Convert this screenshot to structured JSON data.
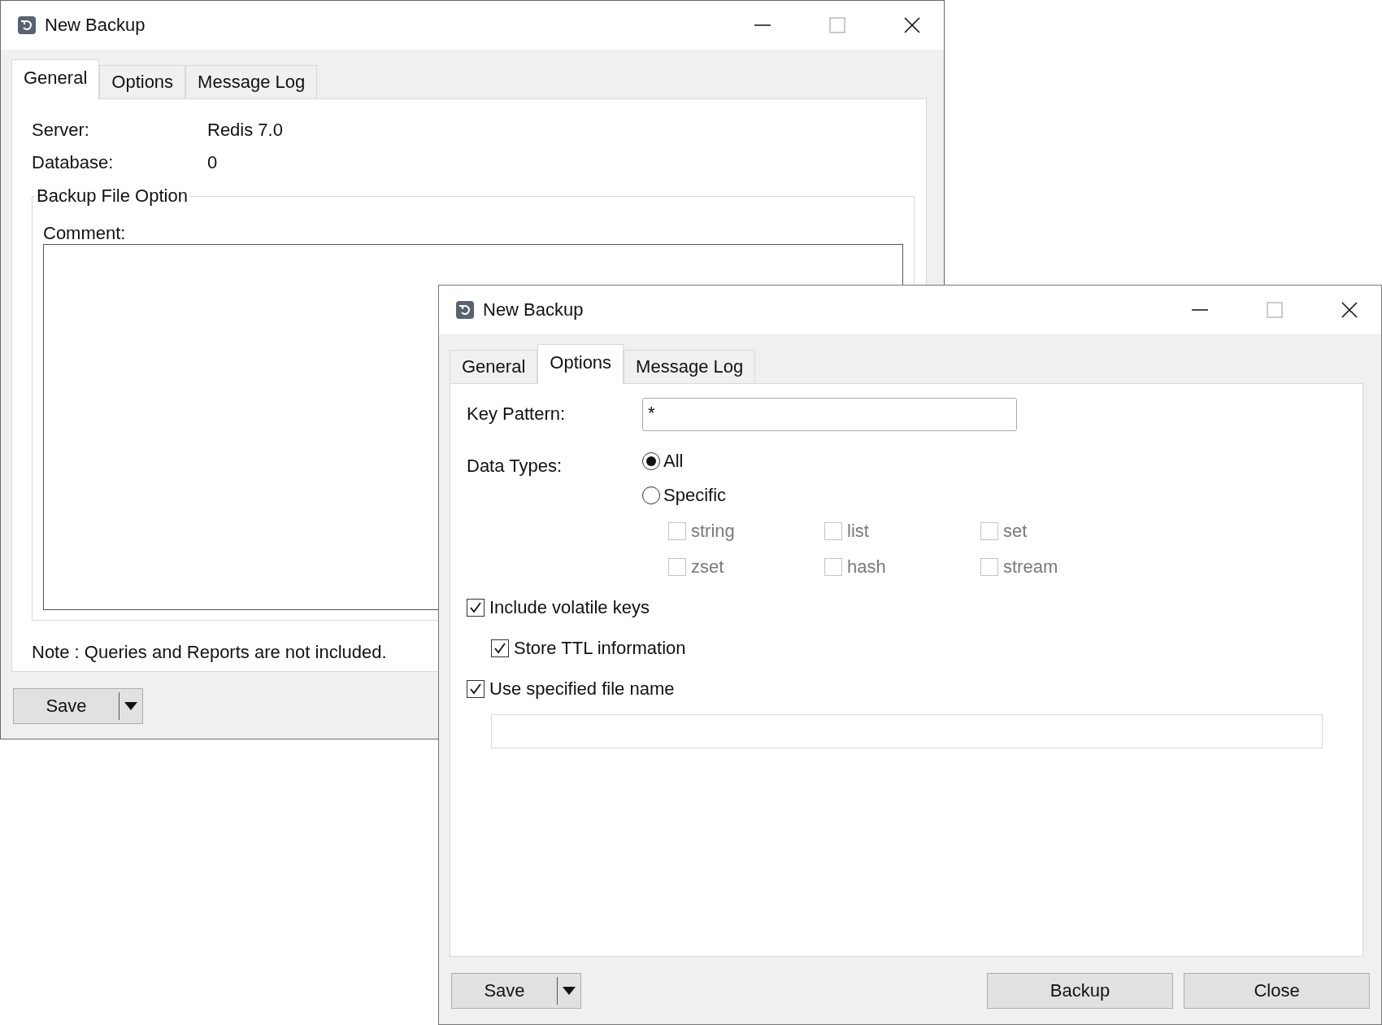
{
  "back_window": {
    "title": "New Backup",
    "tabs": [
      {
        "label": "General",
        "selected": true
      },
      {
        "label": "Options",
        "selected": false
      },
      {
        "label": "Message Log",
        "selected": false
      }
    ],
    "fields": [
      {
        "label": "Server:",
        "value": "Redis 7.0"
      },
      {
        "label": "Database:",
        "value": "0"
      }
    ],
    "group_title": "Backup File Option",
    "comment_label": "Comment:",
    "note": "Note : Queries and Reports are not included.",
    "save_button": "Save"
  },
  "front_window": {
    "title": "New Backup",
    "tabs": [
      {
        "label": "General",
        "selected": false
      },
      {
        "label": "Options",
        "selected": true
      },
      {
        "label": "Message Log",
        "selected": false
      }
    ],
    "key_pattern": {
      "label": "Key Pattern:",
      "value": "*"
    },
    "data_types": {
      "label": "Data Types:",
      "options": [
        {
          "label": "All",
          "selected": true
        },
        {
          "label": "Specific",
          "selected": false
        }
      ],
      "types": [
        {
          "label": "string",
          "checked": false,
          "disabled": true
        },
        {
          "label": "list",
          "checked": false,
          "disabled": true
        },
        {
          "label": "set",
          "checked": false,
          "disabled": true
        },
        {
          "label": "zset",
          "checked": false,
          "disabled": true
        },
        {
          "label": "hash",
          "checked": false,
          "disabled": true
        },
        {
          "label": "stream",
          "checked": false,
          "disabled": true
        }
      ]
    },
    "options": [
      {
        "label": "Include volatile keys",
        "checked": true,
        "children": [
          {
            "label": "Store TTL information",
            "checked": true
          }
        ]
      },
      {
        "label": "Use specified file name",
        "checked": true
      }
    ],
    "buttons": [
      {
        "label": "Save",
        "kind": "split"
      },
      {
        "label": "Backup",
        "kind": "plain"
      },
      {
        "label": "Close",
        "kind": "plain"
      }
    ]
  }
}
